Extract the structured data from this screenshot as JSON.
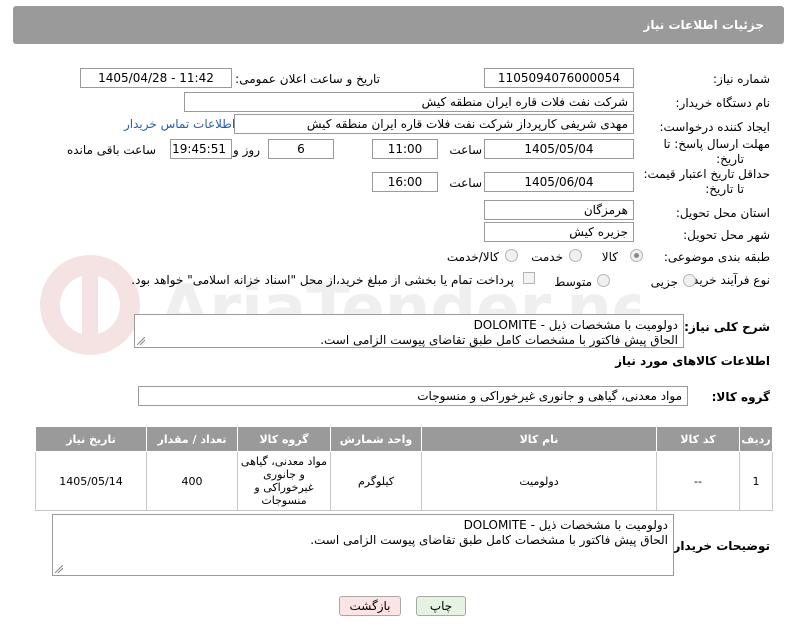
{
  "header": {
    "title": "جزئیات اطلاعات نیاز"
  },
  "fields": {
    "need_number_label": "شماره نیاز:",
    "need_number": "1105094076000054",
    "announce_label": "تاریخ و ساعت اعلان عمومی:",
    "announce_value": "1405/04/28 - 11:42",
    "buyer_org_label": "نام دستگاه خریدار:",
    "buyer_org": "شرکت نفت فلات قاره ایران منطقه کیش",
    "creator_label": "ایجاد کننده درخواست:",
    "creator": "مهدی شریفی کارپرداز شرکت نفت فلات قاره ایران منطقه کیش",
    "contact_link": "اطلاعات تماس خریدار",
    "reply_deadline_label_1": "مهلت ارسال پاسخ: تا",
    "reply_deadline_label_2": "تاریخ:",
    "reply_date": "1405/05/04",
    "time_label": "ساعت",
    "reply_time": "11:00",
    "days": "6",
    "days_label": "روز و",
    "remaining_time": "19:45:51",
    "remaining_label": "ساعت باقی مانده",
    "price_valid_label_1": "حداقل تاریخ اعتبار قیمت:",
    "price_valid_label_2": "تا تاریخ:",
    "price_valid_date": "1405/06/04",
    "price_valid_time": "16:00",
    "province_label": "استان محل تحویل:",
    "province": "هرمزگان",
    "city_label": "شهر محل تحویل:",
    "city": "جزیره کیش"
  },
  "category": {
    "label": "طبقه بندی موضوعی:",
    "options": [
      "کالا",
      "خدمت",
      "کالا/خدمت"
    ],
    "selected": "کالا"
  },
  "process": {
    "label": "نوع فرآیند خرید :",
    "options": [
      "جزیی",
      "متوسط"
    ],
    "selected": "جزیی",
    "payment_note": "پرداخت تمام یا بخشی از مبلغ خرید،از محل \"اسناد خزانه اسلامی\" خواهد بود."
  },
  "summary": {
    "label": "شرح کلی نیاز:",
    "line1": "دولومیت با مشخصات ذیل - DOLOMITE",
    "line2": "الحاق پیش فاکتور با مشخصات کامل طبق تقاضای پیوست الزامی است."
  },
  "goods_info": {
    "title": "اطلاعات کالاهای مورد نیاز",
    "group_label": "گروه کالا:",
    "group_value": "مواد معدنی، گیاهی و جانوری غیرخوراکی و منسوجات"
  },
  "table": {
    "headers": [
      "ردیف",
      "کد کالا",
      "نام کالا",
      "واحد شمارش",
      "گروه کالا",
      "تعداد / مقدار",
      "تاریخ نیاز"
    ],
    "rows": [
      {
        "row": "1",
        "code": "--",
        "name": "دولومیت",
        "unit": "کیلوگرم",
        "group": "مواد معدنی، گیاهی و جانوری غیرخوراکی و منسوجات",
        "qty": "400",
        "date": "1405/05/14"
      }
    ]
  },
  "buyer_notes": {
    "label": "توضیحات خریدار:",
    "line1": "دولومیت با مشخصات ذیل - DOLOMITE",
    "line2": "الحاق پیش فاکتور با مشخصات کامل طبق تقاضای پیوست الزامی است."
  },
  "buttons": {
    "print": "چاپ",
    "back": "بازگشت"
  },
  "watermark": {
    "text": "AriaTender.net"
  },
  "colors": {
    "header_bg": "#9a9a9a",
    "link": "#2a5db0",
    "back_button": "#fde4e4",
    "print_button": "#e7f3e2"
  }
}
